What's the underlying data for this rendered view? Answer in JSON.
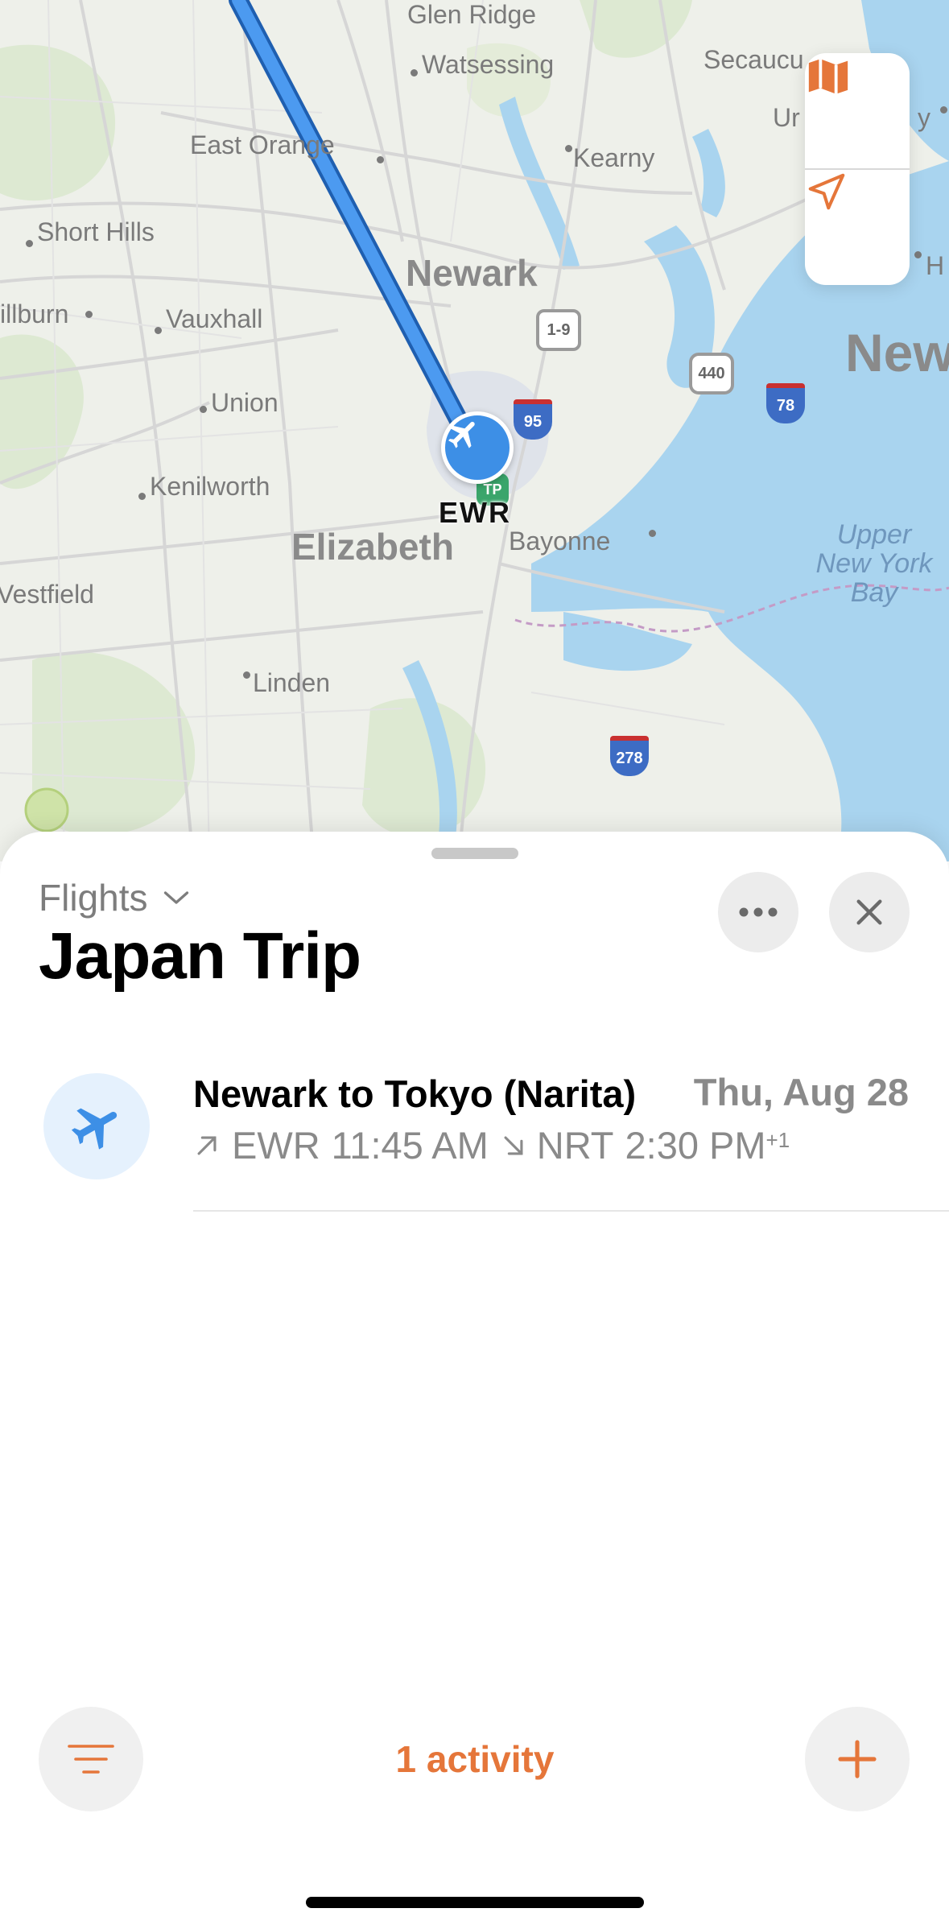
{
  "map": {
    "labels": {
      "glen_ridge": "Glen Ridge",
      "watsessing": "Watsessing",
      "secaucus": "Secaucu",
      "union_city": "Ur",
      "union_city_end": "y",
      "east_orange": "East Orange",
      "kearny": "Kearny",
      "short_hills": "Short Hills",
      "newark": "Newark",
      "hoboken": "H",
      "millburn": "illburn",
      "vauxhall": "Vauxhall",
      "new_york": "New",
      "union": "Union",
      "kenilworth": "Kenilworth",
      "elizabeth": "Elizabeth",
      "bayonne": "Bayonne",
      "upper_bay": "Upper\nNew York\nBay",
      "westfield": "Vestfield",
      "linden": "Linden"
    },
    "shields": {
      "us_1_9": "1-9",
      "i_95": "95",
      "nj_440": "440",
      "i_78": "78",
      "i_278": "278",
      "nj_tp": "TP"
    },
    "airport_code": "EWR",
    "route_color": "#3d8fe6"
  },
  "map_controls": {
    "map_mode_icon": "map-icon",
    "location_icon": "location-arrow-icon"
  },
  "sheet": {
    "section_label": "Flights",
    "title": "Japan Trip",
    "more_icon": "ellipsis-icon",
    "close_icon": "close-icon"
  },
  "flight": {
    "title": "Newark to Tokyo (Narita)",
    "date": "Thu, Aug 28",
    "depart_airport": "EWR",
    "depart_time": "11:45 AM",
    "arrive_airport": "NRT",
    "arrive_time": "2:30 PM",
    "day_offset": "+1",
    "icon": "airplane-icon"
  },
  "footer": {
    "activity_count": "1 activity",
    "filter_icon": "filter-icon",
    "add_icon": "plus-icon"
  },
  "colors": {
    "accent": "#e5763a",
    "flight_blue": "#3d8fe6"
  }
}
